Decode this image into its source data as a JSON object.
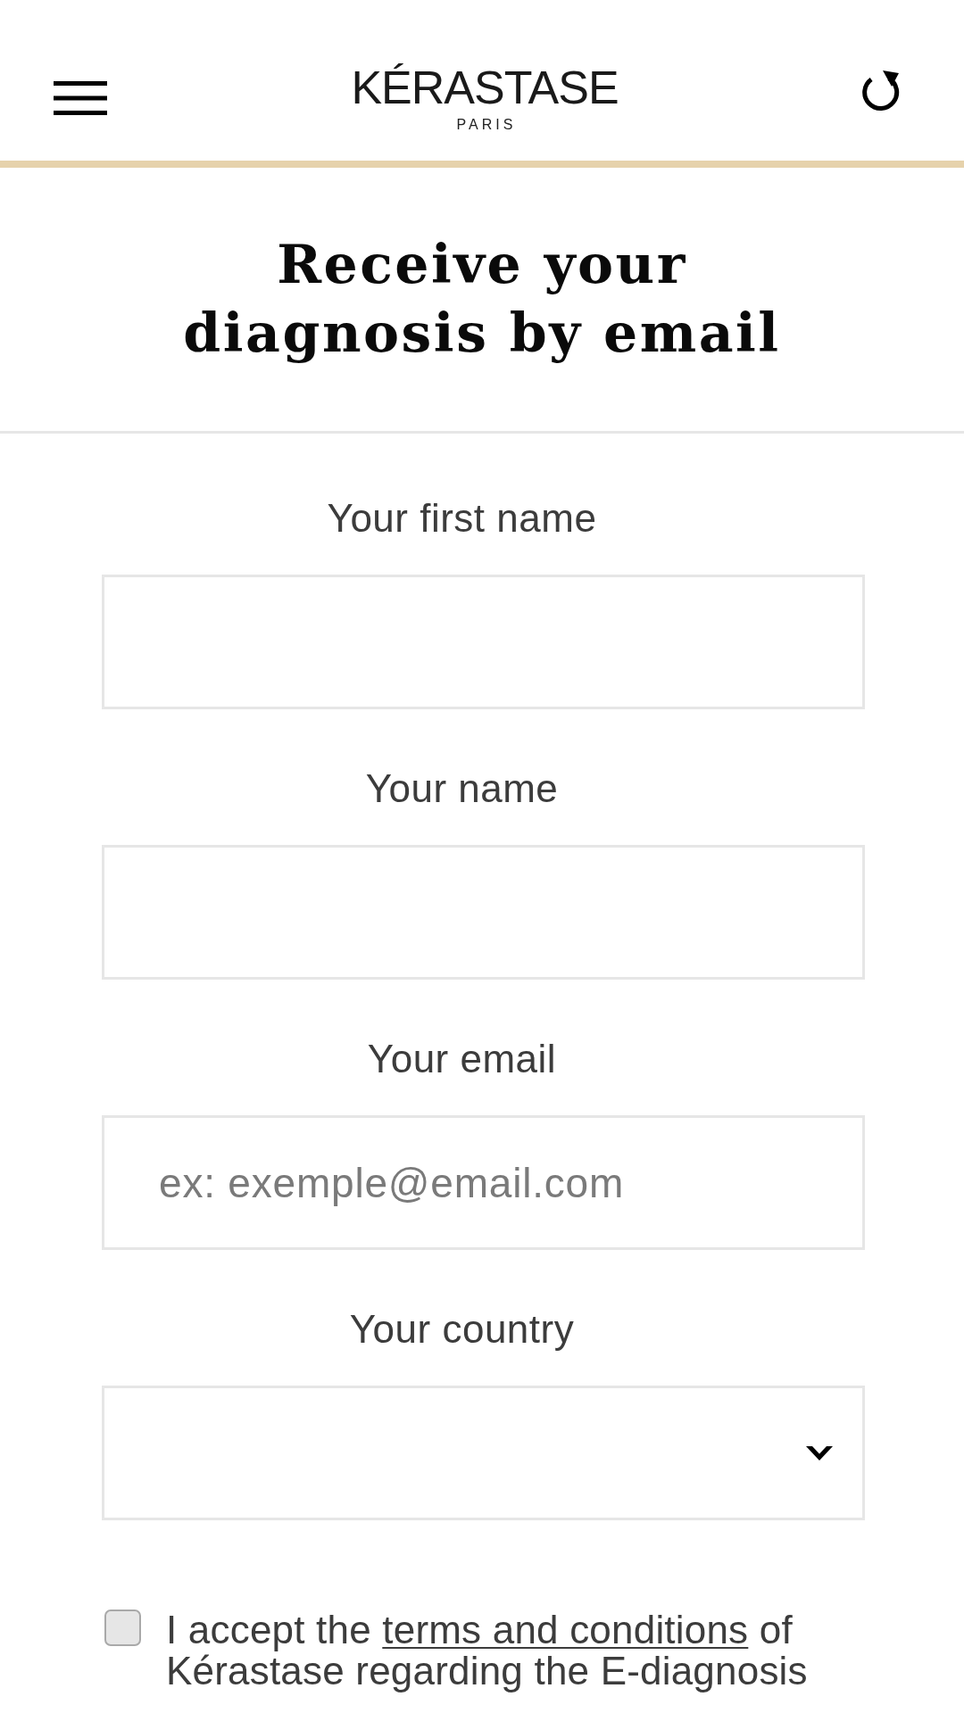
{
  "header": {
    "logo": {
      "wordmark": "KÉRASTASE",
      "tagline": "PARIS"
    }
  },
  "title": "Receive your diagnosis by email",
  "fields": [
    {
      "kind": "text",
      "label": "Your first name"
    },
    {
      "kind": "text",
      "label": "Your name"
    },
    {
      "kind": "text",
      "label": "Your email",
      "placeholder": "ex: exemple@email.com"
    },
    {
      "kind": "select",
      "label": "Your country"
    }
  ],
  "consent": {
    "checked": false,
    "text_before": "I accept the ",
    "link": "terms and conditions",
    "text_after": " of Kérastase regarding the E-diagnosis"
  }
}
